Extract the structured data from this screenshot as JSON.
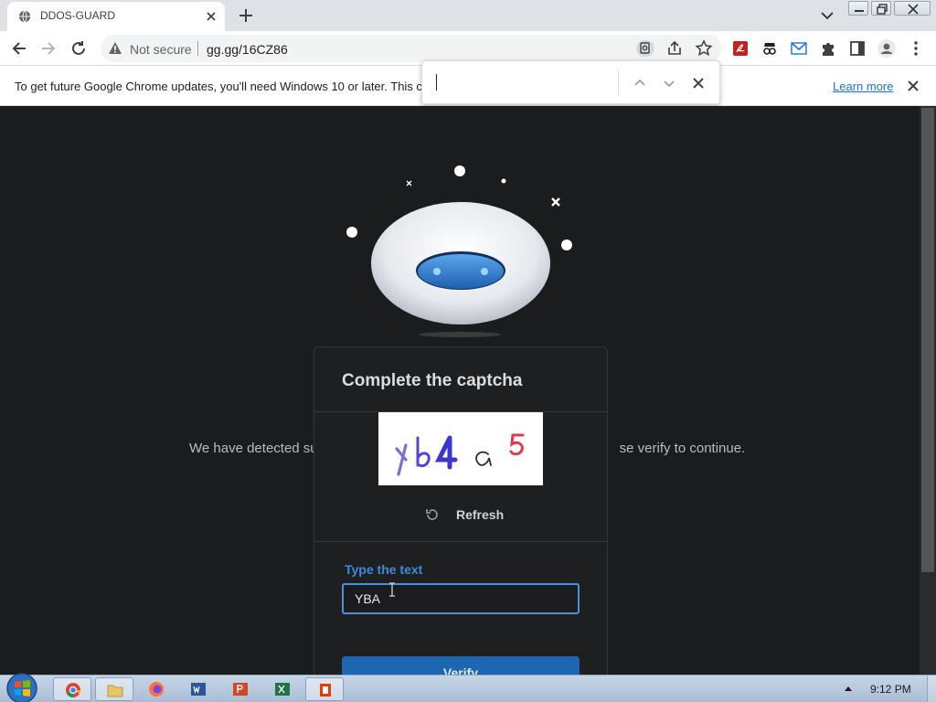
{
  "browser": {
    "tab_title": "DDOS-GUARD",
    "security_label": "Not secure",
    "url": "gg.gg/16CZ86"
  },
  "infobar": {
    "message": "To get future Google Chrome updates, you'll need Windows 10 or later. This c",
    "learn_more": "Learn more"
  },
  "find_bar": {
    "query": ""
  },
  "page": {
    "detect_left": "We have detected su",
    "detect_right": "se verify to continue.",
    "captcha": {
      "heading": "Complete the captcha",
      "image_text": "Yb4a5",
      "refresh_label": "Refresh",
      "input_label": "Type the text",
      "input_value": "YBA",
      "verify_label": "Verify"
    }
  },
  "taskbar": {
    "apps": [
      "chrome",
      "file-explorer",
      "firefox",
      "word",
      "powerpoint",
      "excel",
      "office"
    ],
    "clock": "9:12 PM"
  },
  "colors": {
    "page_bg": "#1b1c1e",
    "card_bg": "#1e1f21",
    "accent_blue": "#1d67b2",
    "label_blue": "#3d8bdc"
  }
}
